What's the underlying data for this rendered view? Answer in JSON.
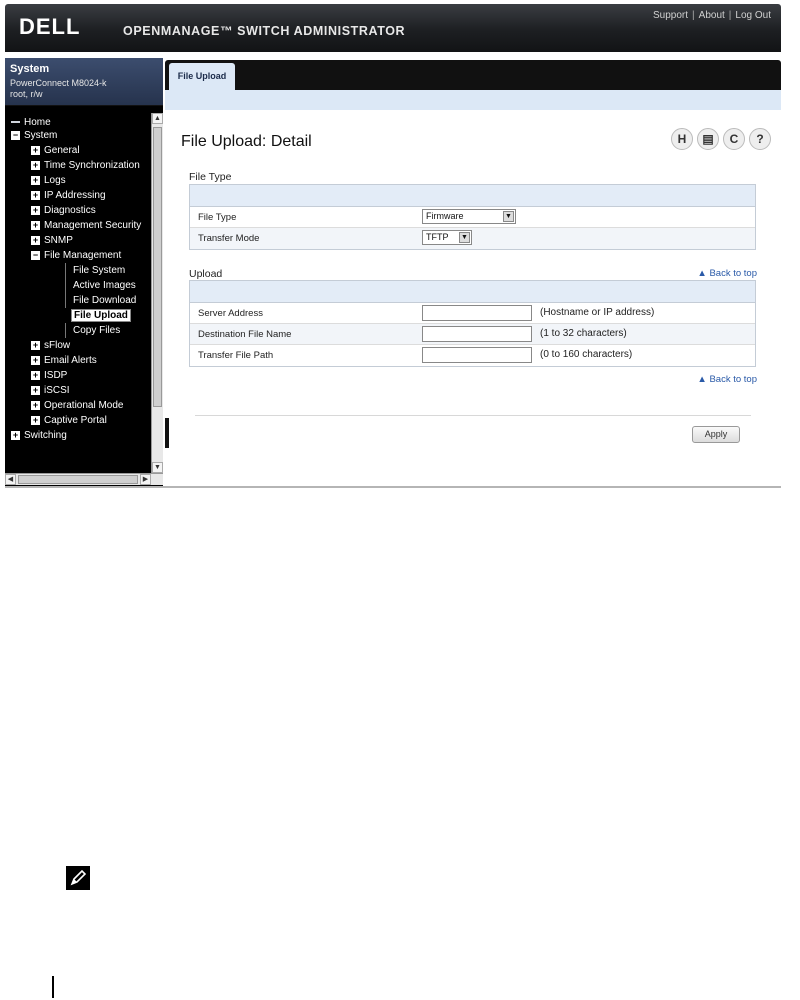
{
  "header": {
    "logo": "DELL",
    "product": "OPENMANAGE™ SWITCH ADMINISTRATOR",
    "links": [
      "Support",
      "About",
      "Log Out"
    ]
  },
  "system_panel": {
    "title": "System",
    "device": "PowerConnect M8024-k",
    "user": "root, r/w"
  },
  "tree": {
    "home": "Home",
    "system": "System",
    "general": "General",
    "time_sync": "Time Synchronization",
    "logs": "Logs",
    "ip_addressing": "IP Addressing",
    "diagnostics": "Diagnostics",
    "mgmt_security": "Management Security",
    "snmp": "SNMP",
    "file_mgmt": "File Management",
    "file_system": "File System",
    "active_images": "Active Images",
    "file_download": "File Download",
    "file_upload": "File Upload",
    "copy_files": "Copy Files",
    "sflow": "sFlow",
    "email_alerts": "Email Alerts",
    "isdp": "ISDP",
    "iscsi": "iSCSI",
    "operational_mode": "Operational Mode",
    "captive_portal": "Captive Portal",
    "switching": "Switching"
  },
  "tab": {
    "label": "File Upload"
  },
  "page": {
    "title": "File Upload: Detail",
    "icons": {
      "save": "H",
      "print": "▤",
      "refresh": "C",
      "help": "?"
    }
  },
  "file_type_section": {
    "title": "File Type",
    "file_type_label": "File Type",
    "file_type_value": "Firmware",
    "transfer_mode_label": "Transfer Mode",
    "transfer_mode_value": "TFTP"
  },
  "upload_section": {
    "title": "Upload",
    "back_to_top": "▲ Back to top",
    "server_address_label": "Server Address",
    "server_address_hint": "(Hostname or IP address)",
    "dest_file_label": "Destination File Name",
    "dest_file_hint": "(1 to 32 characters)",
    "transfer_path_label": "Transfer File Path",
    "transfer_path_hint": "(0 to 160 characters)"
  },
  "footer": {
    "back_to_top": "▲ Back to top",
    "apply": "Apply"
  }
}
